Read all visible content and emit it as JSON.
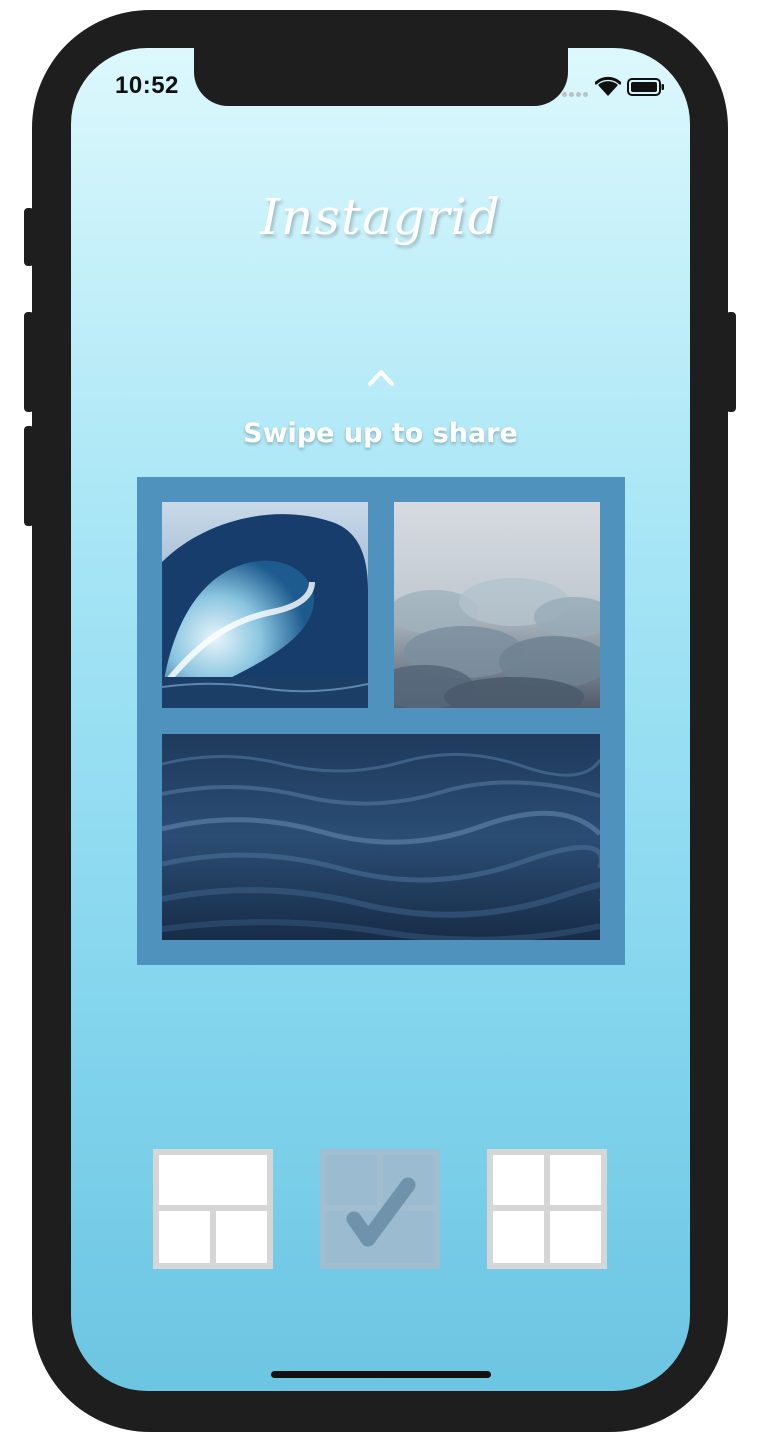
{
  "status_bar": {
    "time": "10:52"
  },
  "app": {
    "title": "Instagrid"
  },
  "swipe": {
    "arrow": "^",
    "label": "Swipe up to share"
  },
  "grid": {
    "background_color": "#4f92bd",
    "photos": [
      {
        "name": "wave-photo",
        "subject": "breaking ocean wave"
      },
      {
        "name": "clouds-photo",
        "subject": "cloud sea"
      },
      {
        "name": "sea-photo",
        "subject": "dark rippling sea"
      }
    ]
  },
  "layout_options": [
    {
      "id": "layout-1",
      "description": "one wide top, two bottom",
      "selected": false
    },
    {
      "id": "layout-2",
      "description": "two top, one wide bottom",
      "selected": true,
      "icon": "checkmark-icon"
    },
    {
      "id": "layout-3",
      "description": "two top, two bottom",
      "selected": false
    }
  ],
  "colors": {
    "background_top": "#dcf8fc",
    "background_bottom": "#6cc5e2",
    "selected_overlay": "#9ec1d5"
  }
}
